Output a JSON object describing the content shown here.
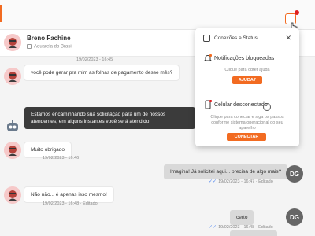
{
  "header": {
    "contact_name": "Breno Fachine",
    "contact_subtitle": "Aquarela do Brasil"
  },
  "messages": [
    {
      "stamp": "19/02/2023 - 16:45",
      "text": "você pode gerar pra mim as folhas de pagamento desse mês?"
    },
    {
      "text": "Estamos encaminhando sua solicitação para um de nossos atendentes, em alguns instantes você será atendido."
    },
    {
      "text": "Muito obrigado",
      "stamp": "19/02/2023 - 16:46"
    },
    {
      "text": "Imagina! Já solicitei aqui... precisa de algo mais?",
      "stamp": "19/02/2023 - 16:47",
      "edited": "Editado"
    },
    {
      "text": "Não não... é apenas isso mesmo!",
      "stamp": "19/02/2023 - 16:48",
      "edited": "Editado"
    },
    {
      "text": "certo",
      "stamp": "19/02/2023 - 16:48",
      "edited": "Editado"
    }
  ],
  "avatars": {
    "agent_initials": "DG"
  },
  "popover": {
    "title": "Conexões e Status",
    "notifications": {
      "label": "Notificações bloqueadas",
      "hint": "Clique para obter ajuda",
      "button": "AJUDA?"
    },
    "phone": {
      "label": "Celular desconectado",
      "hint": "Clique para conectar e siga os passos conforme sistema operacional do seu aparelho",
      "button": "CONECTAR"
    }
  },
  "colors": {
    "accent": "#f26b21",
    "alert": "#e02020",
    "bot_bubble": "#3b3b3b",
    "check": "#5b8def"
  },
  "icons": {
    "notification": "notification-status-icon",
    "bell": "bell-icon",
    "phone": "phone-icon",
    "close": "close-icon",
    "location": "location-icon",
    "toggle": "connect-toggle-icon"
  }
}
